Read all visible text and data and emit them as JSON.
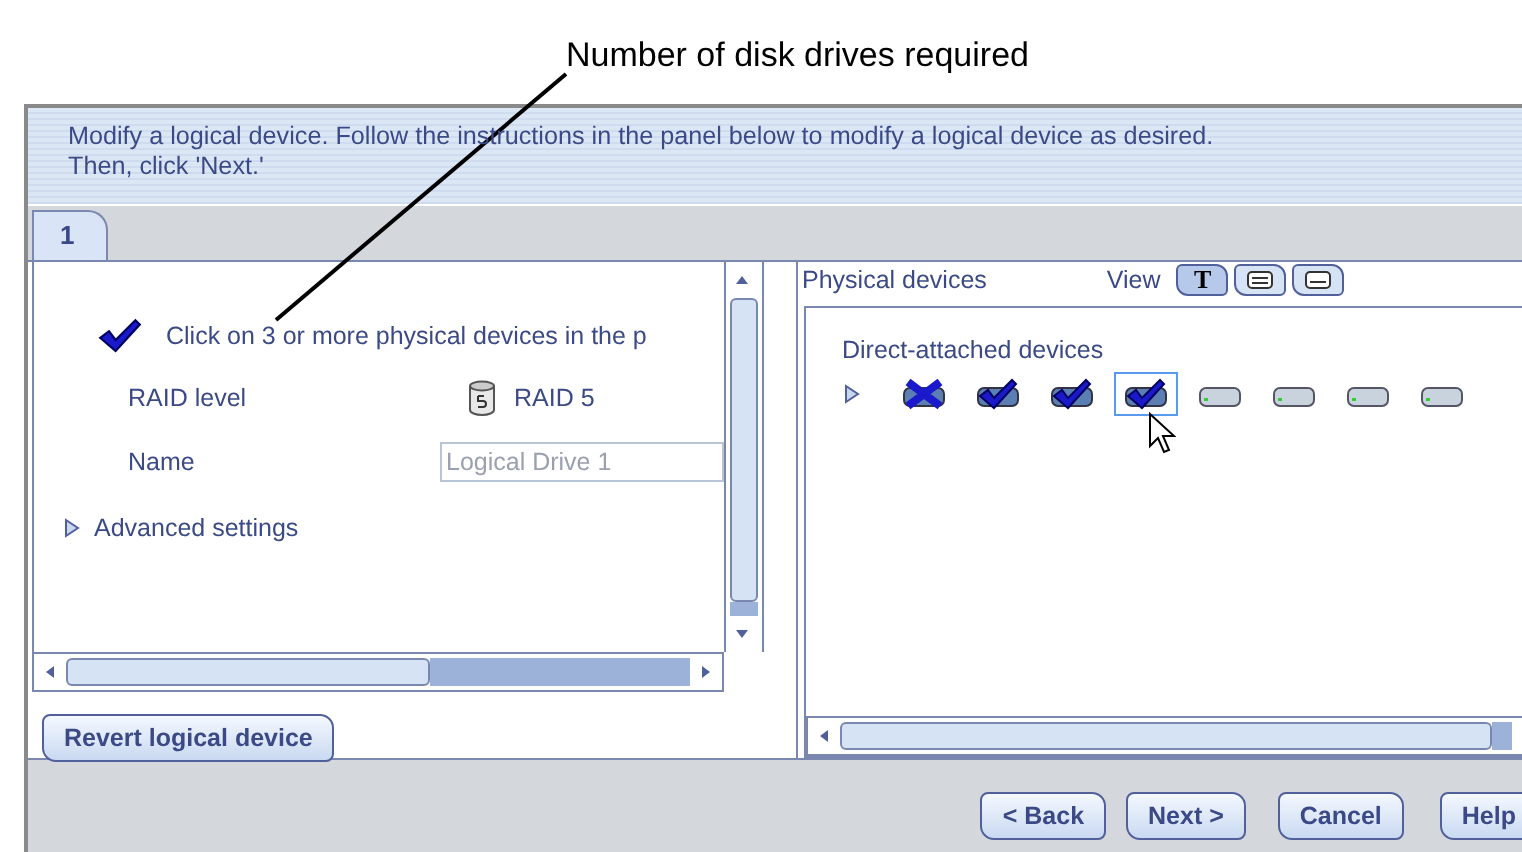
{
  "annotation": {
    "text": "Number of disk drives required"
  },
  "instructions": "Modify a logical device.  Follow the instructions in the panel below to modify a logical device as desired. Then, click 'Next.'",
  "tabs": [
    {
      "label": "1",
      "selected": true
    }
  ],
  "left_panel": {
    "hint": "Click on 3 or more physical devices in the p",
    "fields": [
      {
        "label": "RAID level",
        "kind": "raid",
        "value": "RAID 5"
      },
      {
        "label": "Name",
        "kind": "input",
        "value": "Logical Drive 1",
        "disabled": true
      }
    ],
    "advanced": {
      "label": "Advanced settings",
      "expanded": false
    }
  },
  "revert_button": "Revert logical device",
  "physical": {
    "title": "Physical devices",
    "view_label": "View",
    "views": [
      {
        "kind": "text",
        "label": "T",
        "selected": true
      },
      {
        "kind": "details",
        "selected": false
      },
      {
        "kind": "compact",
        "selected": false
      }
    ],
    "group": {
      "label": "Direct-attached devices",
      "expanded": false,
      "drives": [
        {
          "kind": "failed",
          "focused": false
        },
        {
          "kind": "chosen",
          "focused": false
        },
        {
          "kind": "chosen",
          "focused": false
        },
        {
          "kind": "chosen",
          "focused": true
        },
        {
          "kind": "free",
          "focused": false
        },
        {
          "kind": "free",
          "focused": false
        },
        {
          "kind": "free",
          "focused": false
        },
        {
          "kind": "free",
          "focused": false
        }
      ]
    }
  },
  "buttons": [
    "< Back",
    "Next >",
    "Cancel",
    "Help"
  ]
}
